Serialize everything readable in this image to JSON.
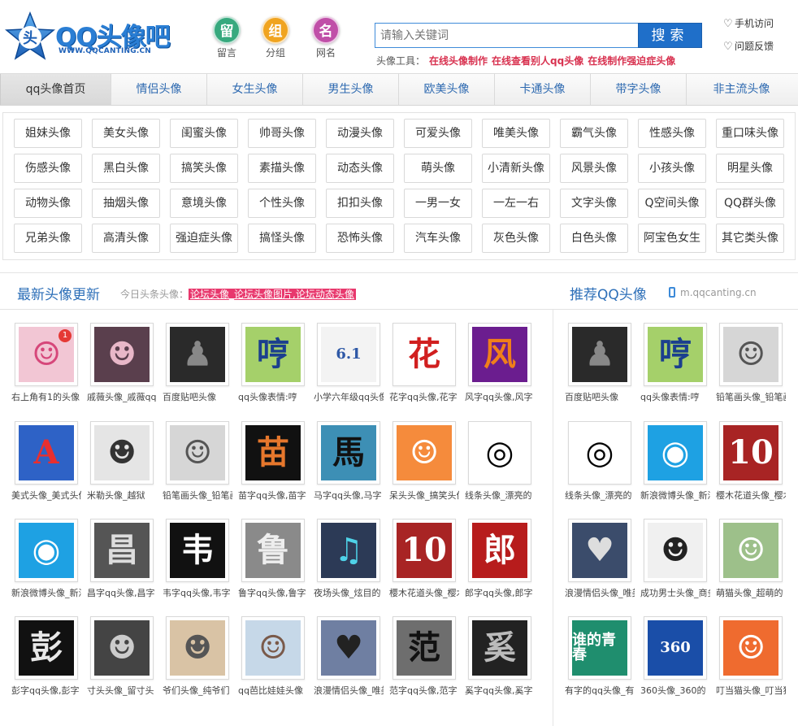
{
  "brand": {
    "name": "QQ头像吧",
    "url": "WWW.QQCANTING.CN",
    "mark_char": "头"
  },
  "quick_links": [
    {
      "char": "留",
      "label": "留言",
      "color": "#37a97e"
    },
    {
      "char": "组",
      "label": "分组",
      "color": "#f0a420"
    },
    {
      "char": "名",
      "label": "网名",
      "color": "#c04fa8"
    }
  ],
  "search": {
    "placeholder": "请输入关键词",
    "button": "搜索"
  },
  "tools": {
    "label": "头像工具：",
    "links": [
      "在线头像制作",
      "在线查看别人qq头像",
      "在线制作强迫症头像"
    ]
  },
  "side_links": [
    "手机访问",
    "问题反馈"
  ],
  "nav": [
    "qq头像首页",
    "情侣头像",
    "女生头像",
    "男生头像",
    "欧美头像",
    "卡通头像",
    "带字头像",
    "非主流头像"
  ],
  "tags": [
    [
      "姐妹头像",
      "美女头像",
      "闺蜜头像",
      "帅哥头像",
      "动漫头像",
      "可爱头像",
      "唯美头像",
      "霸气头像",
      "性感头像",
      "重口味头像"
    ],
    [
      "伤感头像",
      "黑白头像",
      "搞笑头像",
      "素描头像",
      "动态头像",
      "萌头像",
      "小清新头像",
      "风景头像",
      "小孩头像",
      "明星头像"
    ],
    [
      "动物头像",
      "抽烟头像",
      "意境头像",
      "个性头像",
      "扣扣头像",
      "一男一女",
      "一左一右",
      "文字头像",
      "Q空间头像",
      "QQ群头像"
    ],
    [
      "兄弟头像",
      "高清头像",
      "强迫症头像",
      "搞怪头像",
      "恐怖头像",
      "汽车头像",
      "灰色头像",
      "白色头像",
      "阿宝色女生",
      "其它类头像"
    ]
  ],
  "latest": {
    "title": "最新头像更新",
    "today_label": "今日头条头像：",
    "today_headline": "论坛头像_论坛头像图片,论坛动态头像",
    "rows": [
      [
        {
          "caption": "右上角有1的头像",
          "bg": "#f2c6d4",
          "fg": "#d6477a",
          "glyph": "☺",
          "badge": "1"
        },
        {
          "caption": "戚薇头像_戚薇qq头像",
          "bg": "#5a3f4d",
          "fg": "#e8b7c8",
          "glyph": "☻"
        },
        {
          "caption": "百度贴吧头像",
          "bg": "#2a2a2a",
          "fg": "#888",
          "glyph": "♟"
        },
        {
          "caption": "qq头像表情:哼",
          "bg": "#a5d06a",
          "fg": "#1b3f8e",
          "glyph": "哼"
        },
        {
          "caption": "小学六年级qq头像",
          "bg": "#f3f3f3",
          "fg": "#2e58a6",
          "glyph": "6.1"
        },
        {
          "caption": "花字qq头像,花字",
          "bg": "#ffffff",
          "fg": "#d11f1f",
          "glyph": "花"
        },
        {
          "caption": "风字qq头像,风字",
          "bg": "#6b1d8f",
          "fg": "#f07f1a",
          "glyph": "风"
        }
      ],
      [
        {
          "caption": "美式头像_美式头像",
          "bg": "#2e62c6",
          "fg": "#e82f2f",
          "glyph": "A"
        },
        {
          "caption": "米勒头像_越狱",
          "bg": "#e5e5e5",
          "fg": "#333",
          "glyph": "☻"
        },
        {
          "caption": "铅笔画头像_铅笔画",
          "bg": "#d6d6d6",
          "fg": "#555",
          "glyph": "☺"
        },
        {
          "caption": "苗字qq头像,苗字",
          "bg": "#111",
          "fg": "#e6772c",
          "glyph": "苗"
        },
        {
          "caption": "马字qq头像,马字",
          "bg": "#3d8fb5",
          "fg": "#111",
          "glyph": "馬"
        },
        {
          "caption": "呆头头像_搞笑头像",
          "bg": "#f58b3c",
          "fg": "#fff",
          "glyph": "☺"
        },
        {
          "caption": "线条头像_漂亮的",
          "bg": "#ffffff",
          "fg": "#000",
          "glyph": "◎"
        }
      ],
      [
        {
          "caption": "新浪微博头像_新浪",
          "bg": "#1ea1e3",
          "fg": "#fff",
          "glyph": "◉"
        },
        {
          "caption": "昌字qq头像,昌字",
          "bg": "#555",
          "fg": "#ddd",
          "glyph": "昌"
        },
        {
          "caption": "韦字qq头像,韦字",
          "bg": "#111",
          "fg": "#fff",
          "glyph": "韦"
        },
        {
          "caption": "鲁字qq头像,鲁字",
          "bg": "#8a8a8a",
          "fg": "#eee",
          "glyph": "鲁"
        },
        {
          "caption": "夜场头像_炫目的",
          "bg": "#2c3a56",
          "fg": "#4fd2e8",
          "glyph": "♫"
        },
        {
          "caption": "樱木花道头像_樱木",
          "bg": "#a82424",
          "fg": "#fff",
          "glyph": "10"
        },
        {
          "caption": "郎字qq头像,郎字",
          "bg": "#b71c1c",
          "fg": "#fff",
          "glyph": "郎"
        }
      ],
      [
        {
          "caption": "彭字qq头像,彭字",
          "bg": "#111",
          "fg": "#e8e8e8",
          "glyph": "彭"
        },
        {
          "caption": "寸头头像_留寸头",
          "bg": "#444",
          "fg": "#ccc",
          "glyph": "☻"
        },
        {
          "caption": "爷们头像_纯爷们",
          "bg": "#d9c3a5",
          "fg": "#555",
          "glyph": "☻"
        },
        {
          "caption": "qq芭比娃娃头像",
          "bg": "#c6d8e8",
          "fg": "#7a5a4a",
          "glyph": "☺"
        },
        {
          "caption": "浪漫情侣头像_唯美",
          "bg": "#6f7fa2",
          "fg": "#222",
          "glyph": "♥"
        },
        {
          "caption": "范字qq头像,范字",
          "bg": "#6e6e6e",
          "fg": "#111",
          "glyph": "范"
        },
        {
          "caption": "奚字qq头像,奚字",
          "bg": "#222",
          "fg": "#bbb",
          "glyph": "奚"
        }
      ]
    ]
  },
  "recommend": {
    "title": "推荐QQ头像",
    "mobile": "m.qqcanting.cn",
    "rows": [
      [
        {
          "caption": "百度贴吧头像",
          "bg": "#2a2a2a",
          "fg": "#888",
          "glyph": "♟"
        },
        {
          "caption": "qq头像表情:哼",
          "bg": "#a5d06a",
          "fg": "#1b3f8e",
          "glyph": "哼"
        },
        {
          "caption": "铅笔画头像_铅笔画",
          "bg": "#d6d6d6",
          "fg": "#555",
          "glyph": "☺"
        }
      ],
      [
        {
          "caption": "线条头像_漂亮的",
          "bg": "#ffffff",
          "fg": "#000",
          "glyph": "◎"
        },
        {
          "caption": "新浪微博头像_新浪",
          "bg": "#1ea1e3",
          "fg": "#fff",
          "glyph": "◉"
        },
        {
          "caption": "樱木花道头像_樱木",
          "bg": "#a82424",
          "fg": "#fff",
          "glyph": "10"
        }
      ],
      [
        {
          "caption": "浪漫情侣头像_唯美",
          "bg": "#3b4c6b",
          "fg": "#ddd",
          "glyph": "♥"
        },
        {
          "caption": "成功男士头像_商务",
          "bg": "#f0f0f0",
          "fg": "#222",
          "glyph": "☻"
        },
        {
          "caption": "萌猫头像_超萌的",
          "bg": "#9dc08a",
          "fg": "#fff",
          "glyph": "☺"
        }
      ],
      [
        {
          "caption": "有字的qq头像_有字",
          "bg": "#1f8e6e",
          "fg": "#fff",
          "glyph": "谁的青春"
        },
        {
          "caption": "360头像_360的",
          "bg": "#1a4ea8",
          "fg": "#fff",
          "glyph": "360"
        },
        {
          "caption": "叮当猫头像_叮当猫",
          "bg": "#ef6b2f",
          "fg": "#fff",
          "glyph": "☺"
        }
      ]
    ]
  }
}
